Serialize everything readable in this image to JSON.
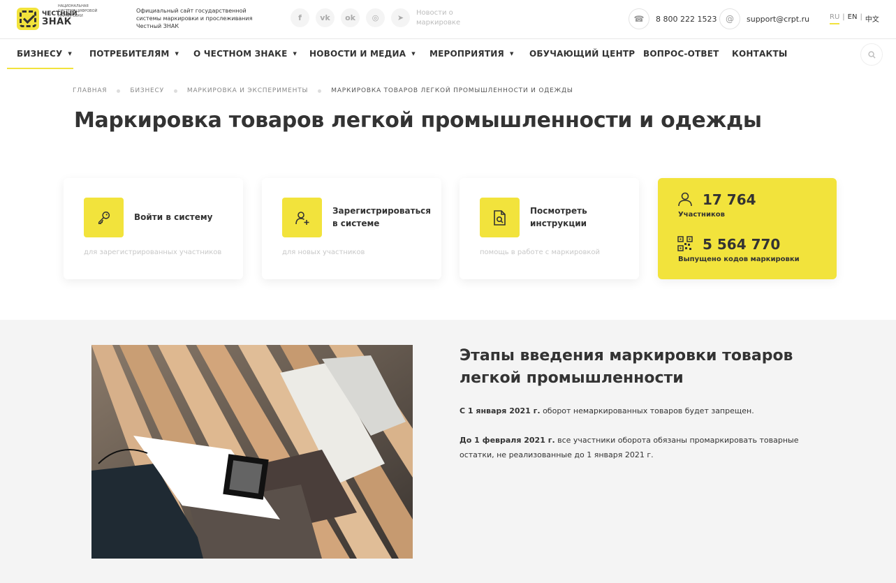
{
  "header": {
    "logo_line1": "ЧЕСТНЫЙ",
    "logo_line2": "ЗНАК",
    "logo_subtitle": "НАЦИОНАЛЬНАЯ СИСТЕМА ЦИФРОВОЙ МАРКИРОВКИ",
    "site_description": "Официальный сайт государственной системы маркировки и прослеживания Честный ЗНАК",
    "socials": [
      {
        "name": "facebook",
        "glyph": "f"
      },
      {
        "name": "vk",
        "glyph": "vk"
      },
      {
        "name": "odnoklassniki",
        "glyph": "ok"
      },
      {
        "name": "instagram",
        "glyph": "◎"
      },
      {
        "name": "telegram",
        "glyph": "➤"
      }
    ],
    "news_link": "Новости о маркировке",
    "phone": "8 800 222 1523",
    "email": "support@crpt.ru",
    "langs": [
      "RU",
      "EN",
      "中文"
    ],
    "active_lang": "RU"
  },
  "nav": {
    "items": [
      {
        "label": "БИЗНЕСУ",
        "dropdown": true,
        "active": true
      },
      {
        "label": "ПОТРЕБИТЕЛЯМ",
        "dropdown": true
      },
      {
        "label": "О ЧЕСТНОМ ЗНАКЕ",
        "dropdown": true
      },
      {
        "label": "НОВОСТИ И МЕДИА",
        "dropdown": true
      },
      {
        "label": "МЕРОПРИЯТИЯ",
        "dropdown": true
      },
      {
        "label": "ОБУЧАЮЩИЙ ЦЕНТР",
        "dropdown": false
      },
      {
        "label": "ВОПРОС-ОТВЕТ",
        "dropdown": false
      },
      {
        "label": "КОНТАКТЫ",
        "dropdown": false
      }
    ],
    "caret": "▼"
  },
  "breadcrumb": [
    "ГЛАВНАЯ",
    "БИЗНЕСУ",
    "МАРКИРОВКА И ЭКСПЕРИМЕНТЫ",
    "МАРКИРОВКА ТОВАРОВ ЛЕГКОЙ ПРОМЫШЛЕННОСТИ И ОДЕЖДЫ"
  ],
  "page_title": "Маркировка товаров легкой промышленности и одежды",
  "cards": [
    {
      "title": "Войти в систему",
      "subtitle": "для зарегистрированных участников",
      "icon": "key-icon"
    },
    {
      "title": "Зарегистрироваться в системе",
      "subtitle": "для новых участников",
      "icon": "user-add-icon"
    },
    {
      "title": "Посмотреть инструкции",
      "subtitle": "помощь в работе с маркировкой",
      "icon": "document-search-icon"
    }
  ],
  "stats": {
    "participants_value": "17 764",
    "participants_label": "Участников",
    "codes_value": "5 564 770",
    "codes_label": "Выпущено кодов маркировки"
  },
  "section": {
    "title": "Этапы введения маркировки товаров легкой промышленности",
    "p1_bold": "С 1 января 2021 г.",
    "p1_rest": " оборот немаркированных товаров будет запрещен.",
    "p2_bold": "До 1 февраля 2021 г.",
    "p2_rest": " все участники оборота обязаны промаркировать товарные остатки, не реализованные до 1 января 2021 г."
  },
  "colors": {
    "accent": "#f2e33c",
    "text": "#333333",
    "muted": "#c8c8c8",
    "section_bg": "#f4f4f4"
  }
}
